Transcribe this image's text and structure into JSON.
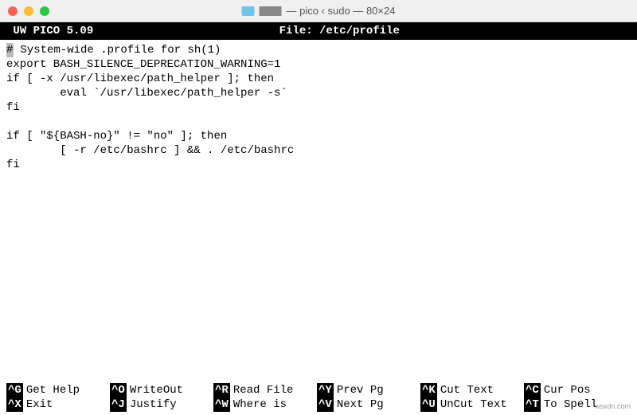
{
  "window": {
    "title": "— pico ‹ sudo — 80×24"
  },
  "status": {
    "app": " UW PICO 5.09 ",
    "file_label": "File: /etc/profile"
  },
  "file_lines": [
    " System-wide .profile for sh(1)",
    "export BASH_SILENCE_DEPRECATION_WARNING=1",
    "if [ -x /usr/libexec/path_helper ]; then",
    "        eval `/usr/libexec/path_helper -s`",
    "fi",
    "",
    "if [ \"${BASH-no}\" != \"no\" ]; then",
    "        [ -r /etc/bashrc ] && . /etc/bashrc",
    "fi",
    ""
  ],
  "cursor_char": "#",
  "help": {
    "row1": [
      {
        "key": "^G",
        "label": "Get Help"
      },
      {
        "key": "^O",
        "label": "WriteOut"
      },
      {
        "key": "^R",
        "label": "Read File"
      },
      {
        "key": "^Y",
        "label": "Prev Pg"
      },
      {
        "key": "^K",
        "label": "Cut Text"
      },
      {
        "key": "^C",
        "label": "Cur Pos"
      }
    ],
    "row2": [
      {
        "key": "^X",
        "label": "Exit"
      },
      {
        "key": "^J",
        "label": "Justify"
      },
      {
        "key": "^W",
        "label": "Where is"
      },
      {
        "key": "^V",
        "label": "Next Pg"
      },
      {
        "key": "^U",
        "label": "UnCut Text"
      },
      {
        "key": "^T",
        "label": "To Spell"
      }
    ]
  },
  "watermark": "wsxdn.com"
}
